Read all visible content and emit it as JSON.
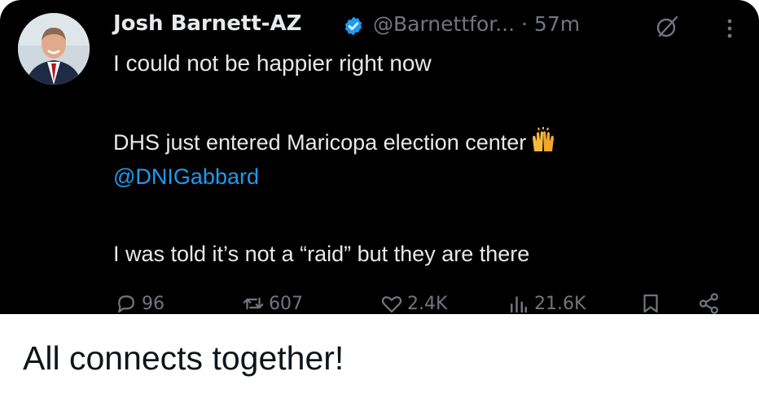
{
  "tweet": {
    "display_name": "Josh Barnett-AZ",
    "handle": "@Barnettfor...",
    "time": "· 57m",
    "lines": [
      "I could not be happier right now",
      "DHS just entered Maricopa election center",
      "@DNIGabbard",
      "I was told it’s not a “raid” but they are there"
    ],
    "emoji": "raising-hands-icon",
    "metrics": {
      "replies": "96",
      "reposts": "607",
      "likes": "2.4K",
      "views": "21.6K"
    }
  },
  "caption": "All connects together!",
  "colors": {
    "card_bg": "#000000",
    "text_primary": "#e7e9ea",
    "text_secondary": "#71767b",
    "link": "#1d9bf0",
    "verified": "#1d9bf0",
    "caption": "#0f1419"
  }
}
